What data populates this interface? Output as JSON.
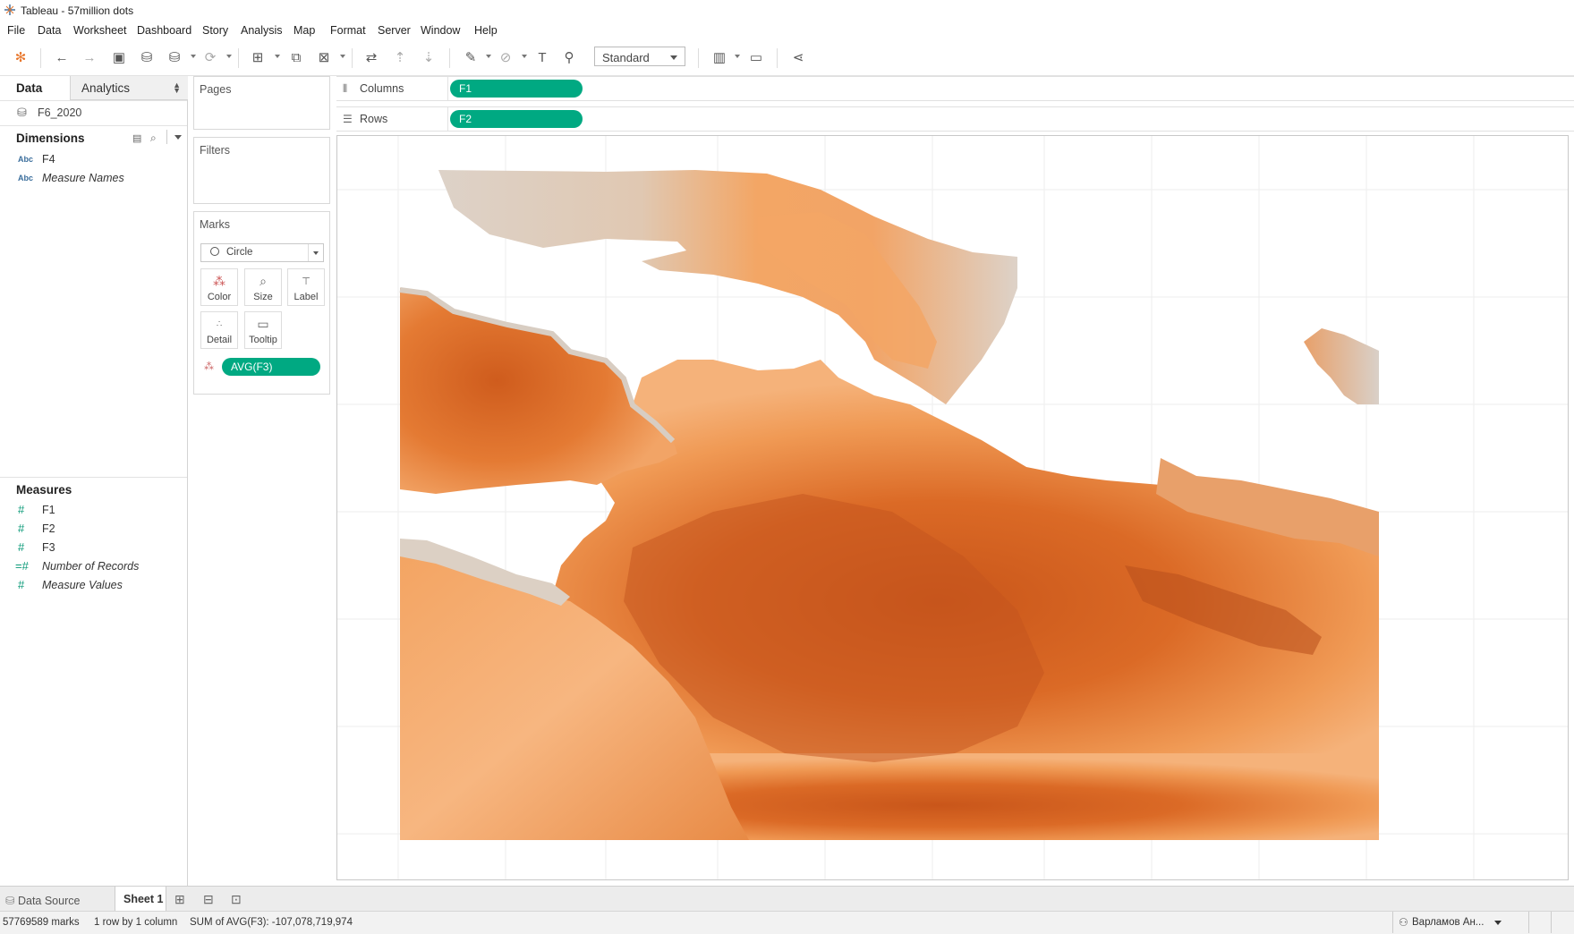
{
  "window": {
    "title": "Tableau - 57million dots"
  },
  "menu": [
    "File",
    "Data",
    "Worksheet",
    "Dashboard",
    "Story",
    "Analysis",
    "Map",
    "Format",
    "Server",
    "Window",
    "Help"
  ],
  "toolbar": {
    "fit_value": "Standard"
  },
  "data_pane": {
    "tab_data": "Data",
    "tab_analytics": "Analytics",
    "datasource": "F6_2020",
    "dimensions_title": "Dimensions",
    "dimensions": [
      {
        "type": "Abc",
        "name": "F4"
      },
      {
        "type": "Abc",
        "name": "Measure Names"
      }
    ],
    "measures_title": "Measures",
    "measures": [
      {
        "type": "#",
        "name": "F1"
      },
      {
        "type": "#",
        "name": "F2"
      },
      {
        "type": "#",
        "name": "F3"
      },
      {
        "type": "=#",
        "name": "Number of Records"
      },
      {
        "type": "#",
        "name": "Measure Values"
      }
    ]
  },
  "cards": {
    "pages": "Pages",
    "filters": "Filters",
    "marks": "Marks",
    "mark_type": "Circle",
    "buttons": {
      "color": "Color",
      "size": "Size",
      "label": "Label",
      "detail": "Detail",
      "tooltip": "Tooltip"
    },
    "color_pill": "AVG(F3)"
  },
  "shelves": {
    "columns_label": "Columns",
    "columns_pill": "F1",
    "rows_label": "Rows",
    "rows_pill": "F2"
  },
  "tabs": {
    "data_source": "Data Source",
    "sheet": "Sheet 1"
  },
  "status": {
    "marks": "57769589 marks",
    "dims": "1 row by 1 column",
    "sum": "SUM of AVG(F3): -107,078,719,974",
    "user": "Варламов Ан..."
  },
  "colors": {
    "pill": "#00a982",
    "low": "#d9cfc6",
    "high": "#c9561a"
  }
}
